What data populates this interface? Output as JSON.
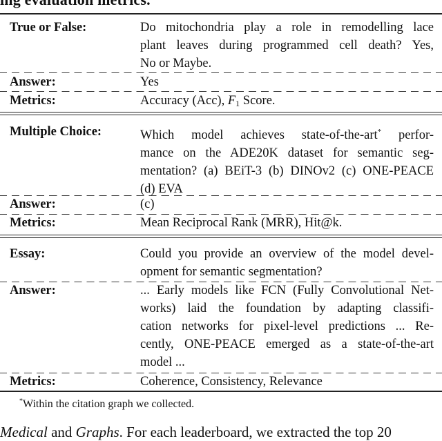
{
  "heading": "ing evaluation metrics.",
  "sections": [
    {
      "type_label": "True or False:",
      "question_lines": [
        "Do mitochondria play a role in remodelling lace",
        "plant leaves during programmed cell death? Yes,",
        "No or Maybe."
      ],
      "answer_label": "Answer:",
      "answer_lines": [
        "Yes"
      ],
      "metrics_label": "Metrics:",
      "metrics": {
        "before": "Accuracy (Acc), ",
        "math_var": "F",
        "math_sub": "1",
        "after": " Score."
      }
    },
    {
      "type_label": "Multiple Choice:",
      "question_lines": [
        "Which model achieves state-of-the-art",
        "mance on the ADE20K dataset for semantic seg-",
        "mentation? (a) BEiT-3 (b) DINOv2 (c) ONE-PEACE",
        "(d) EVA"
      ],
      "question_first_line_sup": "*",
      "question_first_line_tail": " perfor-",
      "answer_label": "Answer:",
      "answer_lines": [
        "(c)"
      ],
      "metrics_label": "Metrics:",
      "metrics_text": "Mean Reciprocal Rank (MRR), Hit@k."
    },
    {
      "type_label": "Essay:",
      "question_lines": [
        "Could you provide an overview of the model devel-",
        "opment for semantic segmentation?"
      ],
      "answer_label": "Answer:",
      "answer_lines": [
        "... Early models like FCN (Fully Convolutional Net-",
        "works) laid the foundation by adapting classifi-",
        "cation networks for pixel-level predictions ... Re-",
        "cently, ONE-PEACE emerged as a state-of-the-art",
        "model ..."
      ],
      "metrics_label": "Metrics:",
      "metrics_text": "Coherence, Consistency, Relevance"
    }
  ],
  "footnote": {
    "marker": "*",
    "text": "Within the citation graph we collected."
  },
  "body_text": {
    "part1_italic": "Medical",
    "part2": " and ",
    "part3_italic": "Graphs",
    "part4": ". For each leaderboard, we extracted the top 20"
  }
}
